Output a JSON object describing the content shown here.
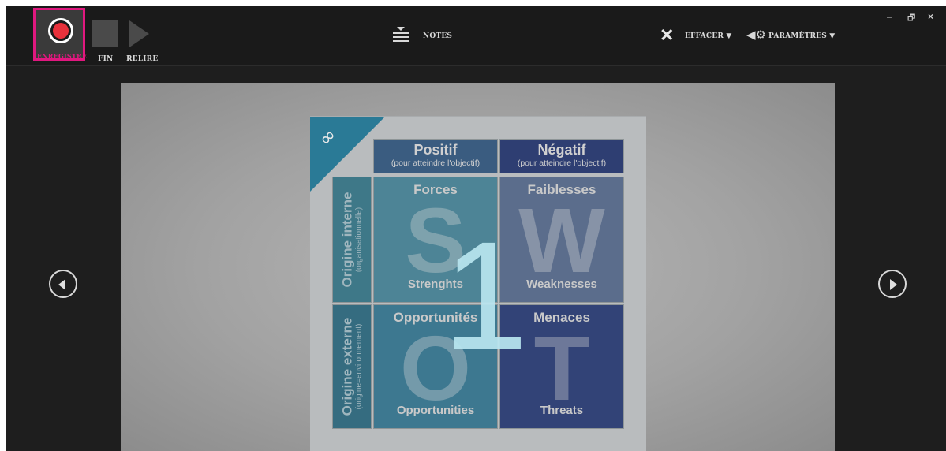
{
  "toolbar": {
    "record_label": "ENREGISTRE",
    "stop_label": "FIN",
    "replay_label": "RELIRE",
    "notes_label": "NOTES",
    "clear_label": "EFFACER ▼",
    "settings_label": "PARAMÈTRES ▼"
  },
  "window_controls": {
    "minimize": "–",
    "maximize": "🗗",
    "close": "×"
  },
  "slide": {
    "number": "1",
    "swot": {
      "corner_icon": "∞",
      "positive": {
        "title": "Positif",
        "subtitle": "(pour atteindre l'objectif)"
      },
      "negative": {
        "title": "Négatif",
        "subtitle": "(pour atteindre l'objectif)"
      },
      "internal": {
        "title": "Origine interne",
        "subtitle": "(organisationnelle)"
      },
      "external": {
        "title": "Origine externe",
        "subtitle": "(origine=environnement)"
      },
      "strengths": {
        "title": "Forces",
        "letter": "S",
        "subtitle": "Strenghts"
      },
      "weaknesses": {
        "title": "Faiblesses",
        "letter": "W",
        "subtitle": "Weaknesses"
      },
      "opportunities": {
        "title": "Opportunités",
        "letter": "O",
        "subtitle": "Opportunities"
      },
      "threats": {
        "title": "Menaces",
        "letter": "T",
        "subtitle": "Threats"
      }
    }
  },
  "colors": {
    "record_highlight": "#e0187f",
    "record_dot": "#e8313b",
    "toolbar_bg": "#1a1a1a"
  }
}
